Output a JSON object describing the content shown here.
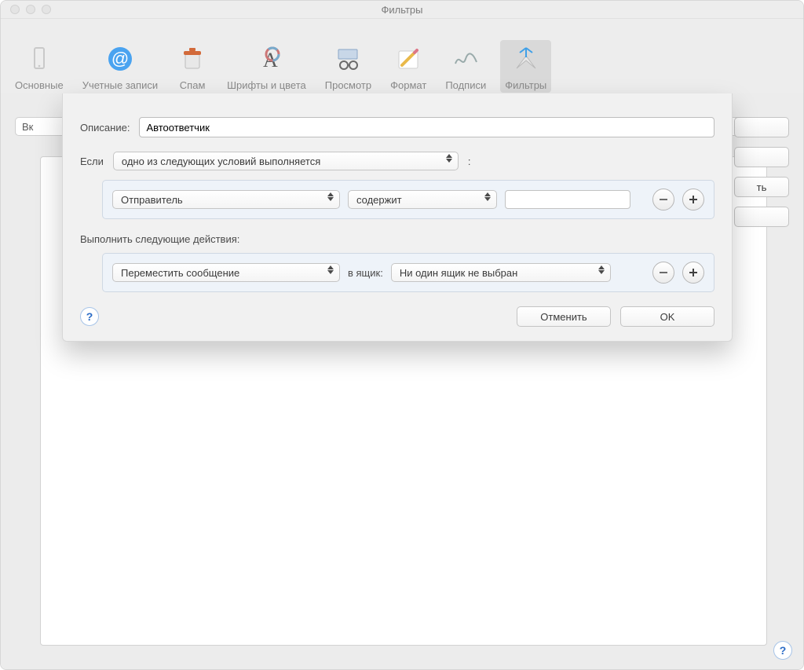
{
  "window": {
    "title": "Фильтры"
  },
  "toolbar": {
    "items": [
      {
        "label": "Основные"
      },
      {
        "label": "Учетные записи"
      },
      {
        "label": "Спам"
      },
      {
        "label": "Шрифты и цвета"
      },
      {
        "label": "Просмотр"
      },
      {
        "label": "Формат"
      },
      {
        "label": "Подписи"
      },
      {
        "label": "Фильтры"
      }
    ]
  },
  "background": {
    "col_header": "Вк",
    "peek_button": "ть"
  },
  "sheet": {
    "description_label": "Описание:",
    "description_value": "Автоответчик",
    "if_label": "Если",
    "if_mode": "одно из следующих условий выполняется",
    "colon": ":",
    "condition": {
      "field": "Отправитель",
      "operator": "содержит",
      "value": ""
    },
    "actions_label": "Выполнить следующие действия:",
    "action": {
      "verb": "Переместить сообщение",
      "into_label": "в ящик:",
      "mailbox": "Ни один ящик не выбран"
    },
    "cancel": "Отменить",
    "ok": "OK"
  },
  "glyphs": {
    "help": "?"
  }
}
